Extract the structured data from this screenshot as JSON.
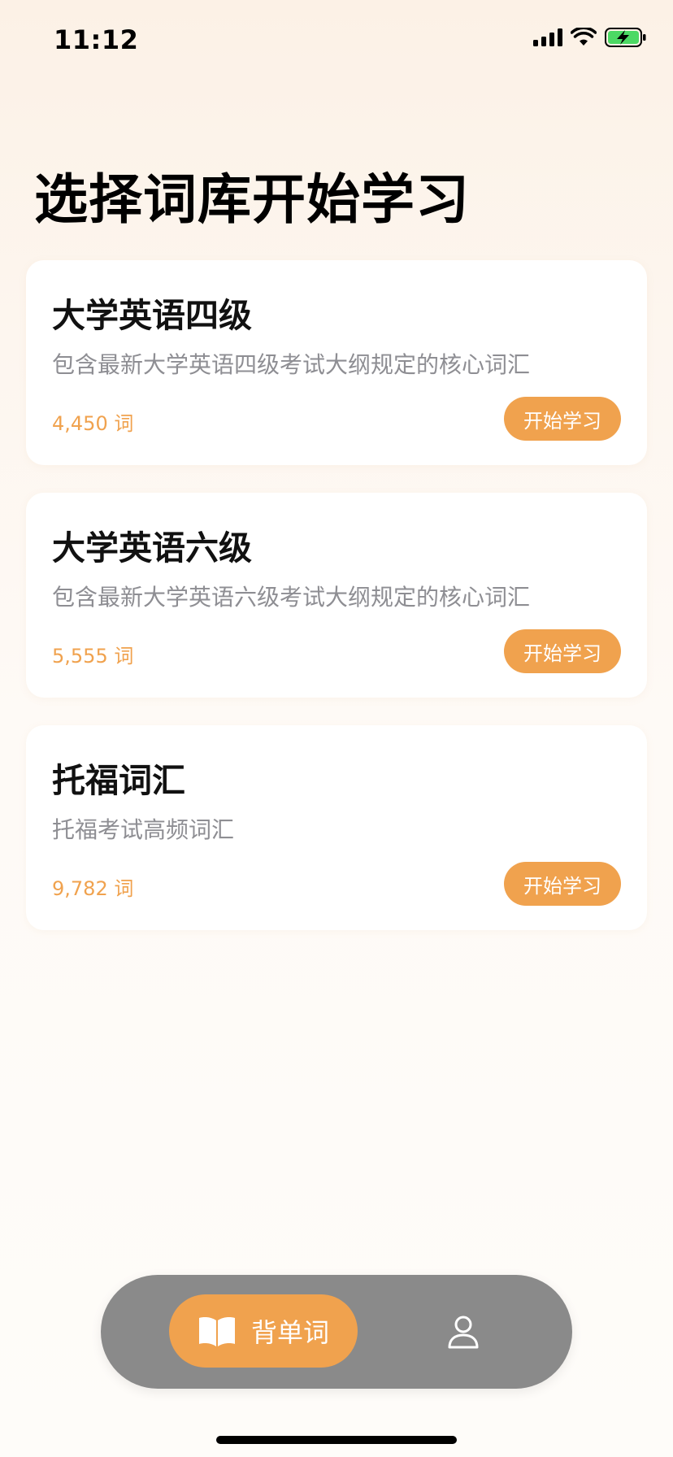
{
  "status_bar": {
    "time": "11:12",
    "icons": [
      "cellular-signal-icon",
      "wifi-icon",
      "battery-charging-icon"
    ],
    "battery_color": "#4cd964"
  },
  "page_title": "选择词库开始学习",
  "accent_color": "#f0a24e",
  "word_books": [
    {
      "title": "大学英语四级",
      "description": "包含最新大学英语四级考试大纲规定的核心词汇",
      "count": "4,450 词",
      "button": "开始学习"
    },
    {
      "title": "大学英语六级",
      "description": "包含最新大学英语六级考试大纲规定的核心词汇",
      "count": "5,555 词",
      "button": "开始学习"
    },
    {
      "title": "托福词汇",
      "description": "托福考试高频词汇",
      "count": "9,782 词",
      "button": "开始学习"
    }
  ],
  "tab_bar": {
    "active_tab": {
      "label": "背单词",
      "icon": "open-book-icon"
    },
    "profile_tab": {
      "icon": "person-icon"
    }
  }
}
